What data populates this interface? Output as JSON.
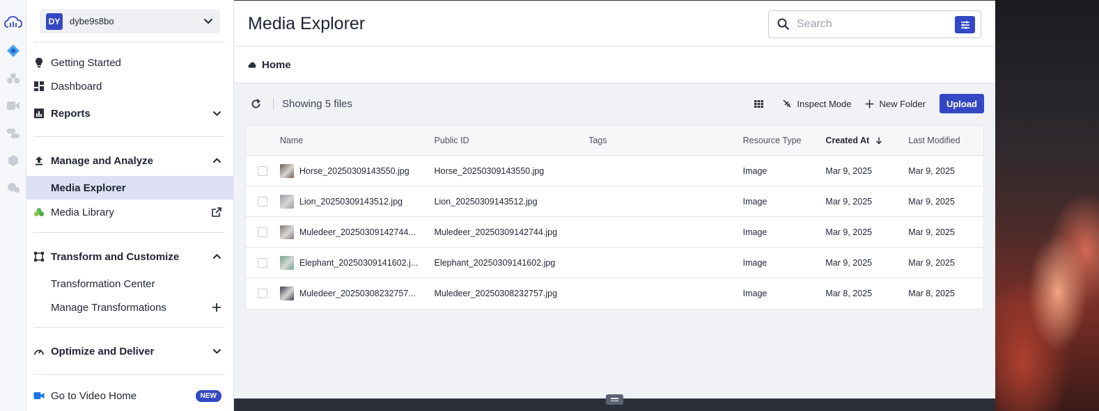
{
  "account": {
    "initials": "DY",
    "name": "dybe9s8bo"
  },
  "sidebar": {
    "getting_started": "Getting Started",
    "dashboard": "Dashboard",
    "reports": "Reports",
    "manage_analyze": "Manage and Analyze",
    "media_explorer": "Media Explorer",
    "media_library": "Media Library",
    "transform_customize": "Transform and Customize",
    "transformation_center": "Transformation Center",
    "manage_transformations": "Manage Transformations",
    "optimize_deliver": "Optimize and Deliver",
    "video_home": "Go to Video Home",
    "new_badge": "NEW"
  },
  "header": {
    "title": "Media Explorer",
    "search_placeholder": "Search"
  },
  "breadcrumb": {
    "home": "Home"
  },
  "toolbar": {
    "showing": "Showing 5 files",
    "inspect_mode": "Inspect Mode",
    "new_folder": "New Folder",
    "upload": "Upload"
  },
  "table": {
    "columns": [
      "Name",
      "Public ID",
      "Tags",
      "Resource Type",
      "Created At",
      "Last Modified"
    ],
    "rows": [
      {
        "name": "Horse_20250309143550.jpg",
        "public_id": "Horse_20250309143550.jpg",
        "tags": "",
        "type": "Image",
        "created": "Mar 9, 2025",
        "modified": "Mar 9, 2025",
        "thumb_color": "#6b5a52"
      },
      {
        "name": "Lion_20250309143512.jpg",
        "public_id": "Lion_20250309143512.jpg",
        "tags": "",
        "type": "Image",
        "created": "Mar 9, 2025",
        "modified": "Mar 9, 2025",
        "thumb_color": "#9a9aa2"
      },
      {
        "name": "Muledeer_20250309142744...",
        "public_id": "Muledeer_20250309142744.jpg",
        "tags": "",
        "type": "Image",
        "created": "Mar 9, 2025",
        "modified": "Mar 9, 2025",
        "thumb_color": "#7e7a78"
      },
      {
        "name": "Elephant_20250309141602.j...",
        "public_id": "Elephant_20250309141602.jpg",
        "tags": "",
        "type": "Image",
        "created": "Mar 9, 2025",
        "modified": "Mar 9, 2025",
        "thumb_color": "#6fa58e"
      },
      {
        "name": "Muledeer_20250308232757...",
        "public_id": "Muledeer_20250308232757.jpg",
        "tags": "",
        "type": "Image",
        "created": "Mar 8, 2025",
        "modified": "Mar 8, 2025",
        "thumb_color": "#3a3e48"
      }
    ]
  },
  "colors": {
    "accent": "#3448c5",
    "active_nav": "#dde1f3"
  }
}
